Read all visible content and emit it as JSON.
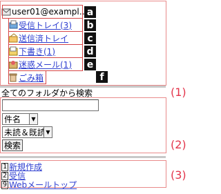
{
  "folders": {
    "account": "user01@exampl…",
    "items": [
      {
        "label": "受信トレイ(3)",
        "badge": "b",
        "icon": "inbox-icon"
      },
      {
        "label": "送信済トレイ",
        "badge": "c",
        "icon": "sent-icon"
      },
      {
        "label": "下書き(1)",
        "badge": "d",
        "icon": "drafts-icon"
      },
      {
        "label": "迷惑メール(1)",
        "badge": "e",
        "icon": "spam-icon"
      },
      {
        "label": "ごみ箱",
        "badge": "f",
        "icon": "trash-icon"
      }
    ],
    "account_badge": "a"
  },
  "search": {
    "title": "全てのフォルダから検索",
    "input_value": "",
    "field_select": "件名",
    "read_select": "未読＆既読",
    "button": "検索"
  },
  "menu": {
    "items": [
      {
        "key": "1",
        "label": "新規作成"
      },
      {
        "key": "2",
        "label": "受信"
      },
      {
        "key": "9",
        "label": "Webメールトップ"
      }
    ]
  },
  "section_labels": [
    "(1)",
    "(2)",
    "(3)"
  ],
  "colors": {
    "link": "#2f3fd0",
    "annotation": "#e3344a",
    "frame": "#e98a8a"
  }
}
